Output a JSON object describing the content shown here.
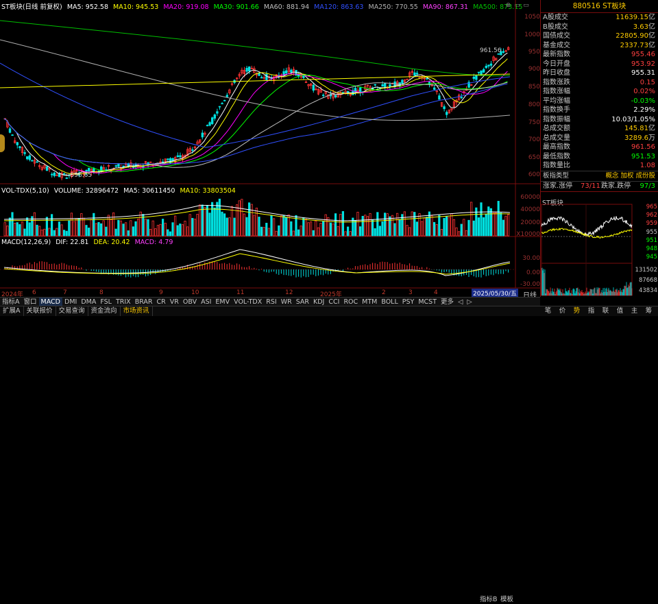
{
  "legend": {
    "title": "ST板块(日线 前复权)",
    "ma5": "MA5: 952.58",
    "ma10": "MA10: 945.53",
    "ma20": "MA20: 919.08",
    "ma30": "MA30: 901.66",
    "ma60": "MA60: 881.94",
    "ma120": "MA120: 863.63",
    "ma250": "MA250: 770.55",
    "ma90": "MA90: 867.31",
    "ma500": "MA500: 873.15",
    "colors": {
      "title": "#ffffff",
      "ma5": "#ffffff",
      "ma10": "#ffff00",
      "ma20": "#ff00ff",
      "ma30": "#00ff00",
      "ma60": "#c0c0c0",
      "ma120": "#3050ff",
      "ma250": "#b0b0b0",
      "ma90": "#ff40ff",
      "ma500": "#00c000"
    }
  },
  "price_axis": [
    "1050",
    "1000",
    "950",
    "900",
    "850",
    "800",
    "750",
    "700",
    "650",
    "600"
  ],
  "annotations": {
    "high": "961.56",
    "low": "596.65"
  },
  "volume": {
    "label": "VOL-TDX(5,10)",
    "volume": "VOLUME: 32896472",
    "ma5": "MA5: 30611450",
    "ma10": "MA10: 33803504",
    "axis": [
      "60000",
      "40000",
      "20000",
      "X10000"
    ]
  },
  "macd": {
    "label": "MACD(12,26,9)",
    "dif": "DIF: 22.81",
    "dea": "DEA: 20.42",
    "macd": "MACD: 4.79",
    "axis": [
      "30.00",
      "0.00",
      "-30.00"
    ]
  },
  "dates": {
    "d1": "2024年",
    "d2": "6",
    "d3": "7",
    "d4": "8",
    "d5": "9",
    "d6": "10",
    "d7": "11",
    "d8": "12",
    "d9": "2025年",
    "d10": "2",
    "d11": "3",
    "d12": "4",
    "cursor": "2025/05/30/五"
  },
  "tabs": [
    "指标A",
    "窗口",
    "MACD",
    "DMI",
    "DMA",
    "FSL",
    "TRIX",
    "BRAR",
    "CR",
    "VR",
    "OBV",
    "ASI",
    "EMV",
    "VOL-TDX",
    "RSI",
    "WR",
    "SAR",
    "KDJ",
    "CCI",
    "ROC",
    "MTM",
    "BOLL",
    "PSY",
    "MCST",
    "更多",
    "◁",
    "▷"
  ],
  "tab_right": {
    "b": "指标B",
    "m": "模板",
    "d": "日线"
  },
  "bottom_tabs": [
    "扩展A",
    "关联报价",
    "交易查询",
    "资金流向",
    "市场资讯"
  ],
  "panel": {
    "title": "880516 ST板块",
    "stats": [
      {
        "label": "A股成交",
        "value": "11639.15",
        "unit": "亿",
        "color": "#ffcc00"
      },
      {
        "label": "B股成交",
        "value": "3.63",
        "unit": "亿",
        "color": "#ffcc00"
      },
      {
        "label": "国债成交",
        "value": "22805.90",
        "unit": "亿",
        "color": "#ffcc00"
      },
      {
        "label": "基金成交",
        "value": "2337.73",
        "unit": "亿",
        "color": "#ffcc00"
      },
      {
        "label": "最新指数",
        "value": "955.46",
        "unit": "",
        "color": "#ff4040"
      },
      {
        "label": "今日开盘",
        "value": "953.92",
        "unit": "",
        "color": "#ff4040"
      },
      {
        "label": "昨日收盘",
        "value": "955.31",
        "unit": "",
        "color": "#ffffff"
      },
      {
        "label": "指数涨跌",
        "value": "0.15",
        "unit": "",
        "color": "#ff4040"
      },
      {
        "label": "指数涨幅",
        "value": "0.02%",
        "unit": "",
        "color": "#ff4040"
      },
      {
        "label": "平均涨幅",
        "value": "-0.03%",
        "unit": "",
        "color": "#00ff00"
      },
      {
        "label": "指数换手",
        "value": "2.29%",
        "unit": "",
        "color": "#ffffff"
      },
      {
        "label": "指数振幅",
        "value": "10.03/1.05%",
        "unit": "",
        "color": "#ffffff"
      },
      {
        "label": "总成交额",
        "value": "145.81",
        "unit": "亿",
        "color": "#ffcc00"
      },
      {
        "label": "总成交量",
        "value": "3289.6",
        "unit": "万",
        "color": "#ffcc00"
      },
      {
        "label": "最高指数",
        "value": "961.56",
        "unit": "",
        "color": "#ff4040"
      },
      {
        "label": "最低指数",
        "value": "951.53",
        "unit": "",
        "color": "#00ff00"
      },
      {
        "label": "指数量比",
        "value": "1.08",
        "unit": "",
        "color": "#ff4040"
      }
    ],
    "sector_type_label": "板指类型",
    "sector_types": "概念 加权 成份股",
    "up_label": "涨家.涨停",
    "up_value": "73/11",
    "down_label": "跌家.跌停",
    "down_value": "97/3"
  },
  "mini": {
    "title": "ST板块",
    "axis_right": [
      "965",
      "962",
      "959",
      "955",
      "951",
      "948",
      "945"
    ],
    "vol_axis": [
      "131502",
      "87668",
      "43834"
    ]
  },
  "right_tabs": [
    "笔",
    "价",
    "势",
    "指",
    "联",
    "值",
    "主",
    "筹"
  ],
  "chart_data": {
    "type": "candlestick",
    "ylim": [
      580,
      1070
    ],
    "note_low": 596.65,
    "note_high": 961.56
  }
}
